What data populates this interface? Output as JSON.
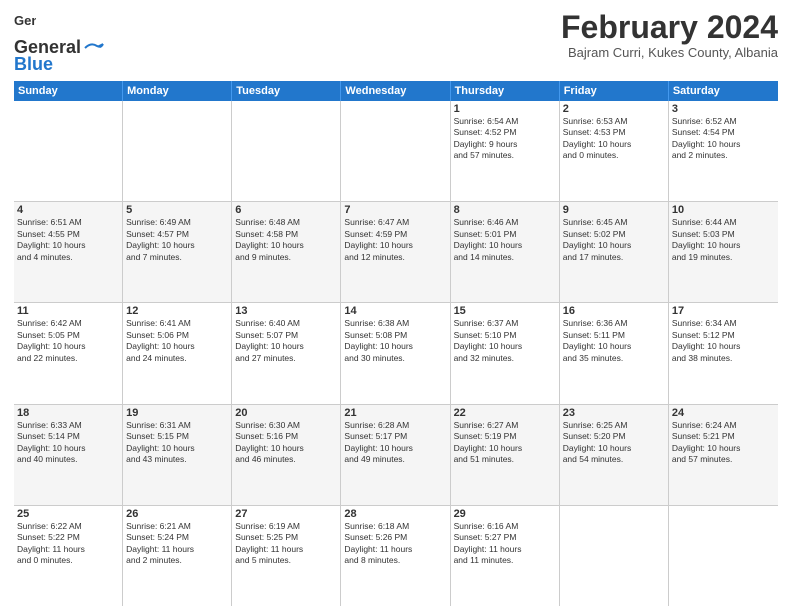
{
  "logo": {
    "line1": "General",
    "line2": "Blue"
  },
  "title": "February 2024",
  "subtitle": "Bajram Curri, Kukes County, Albania",
  "days_header": [
    "Sunday",
    "Monday",
    "Tuesday",
    "Wednesday",
    "Thursday",
    "Friday",
    "Saturday"
  ],
  "weeks": [
    [
      {
        "day": "",
        "info": ""
      },
      {
        "day": "",
        "info": ""
      },
      {
        "day": "",
        "info": ""
      },
      {
        "day": "",
        "info": ""
      },
      {
        "day": "1",
        "info": "Sunrise: 6:54 AM\nSunset: 4:52 PM\nDaylight: 9 hours\nand 57 minutes."
      },
      {
        "day": "2",
        "info": "Sunrise: 6:53 AM\nSunset: 4:53 PM\nDaylight: 10 hours\nand 0 minutes."
      },
      {
        "day": "3",
        "info": "Sunrise: 6:52 AM\nSunset: 4:54 PM\nDaylight: 10 hours\nand 2 minutes."
      }
    ],
    [
      {
        "day": "4",
        "info": "Sunrise: 6:51 AM\nSunset: 4:55 PM\nDaylight: 10 hours\nand 4 minutes."
      },
      {
        "day": "5",
        "info": "Sunrise: 6:49 AM\nSunset: 4:57 PM\nDaylight: 10 hours\nand 7 minutes."
      },
      {
        "day": "6",
        "info": "Sunrise: 6:48 AM\nSunset: 4:58 PM\nDaylight: 10 hours\nand 9 minutes."
      },
      {
        "day": "7",
        "info": "Sunrise: 6:47 AM\nSunset: 4:59 PM\nDaylight: 10 hours\nand 12 minutes."
      },
      {
        "day": "8",
        "info": "Sunrise: 6:46 AM\nSunset: 5:01 PM\nDaylight: 10 hours\nand 14 minutes."
      },
      {
        "day": "9",
        "info": "Sunrise: 6:45 AM\nSunset: 5:02 PM\nDaylight: 10 hours\nand 17 minutes."
      },
      {
        "day": "10",
        "info": "Sunrise: 6:44 AM\nSunset: 5:03 PM\nDaylight: 10 hours\nand 19 minutes."
      }
    ],
    [
      {
        "day": "11",
        "info": "Sunrise: 6:42 AM\nSunset: 5:05 PM\nDaylight: 10 hours\nand 22 minutes."
      },
      {
        "day": "12",
        "info": "Sunrise: 6:41 AM\nSunset: 5:06 PM\nDaylight: 10 hours\nand 24 minutes."
      },
      {
        "day": "13",
        "info": "Sunrise: 6:40 AM\nSunset: 5:07 PM\nDaylight: 10 hours\nand 27 minutes."
      },
      {
        "day": "14",
        "info": "Sunrise: 6:38 AM\nSunset: 5:08 PM\nDaylight: 10 hours\nand 30 minutes."
      },
      {
        "day": "15",
        "info": "Sunrise: 6:37 AM\nSunset: 5:10 PM\nDaylight: 10 hours\nand 32 minutes."
      },
      {
        "day": "16",
        "info": "Sunrise: 6:36 AM\nSunset: 5:11 PM\nDaylight: 10 hours\nand 35 minutes."
      },
      {
        "day": "17",
        "info": "Sunrise: 6:34 AM\nSunset: 5:12 PM\nDaylight: 10 hours\nand 38 minutes."
      }
    ],
    [
      {
        "day": "18",
        "info": "Sunrise: 6:33 AM\nSunset: 5:14 PM\nDaylight: 10 hours\nand 40 minutes."
      },
      {
        "day": "19",
        "info": "Sunrise: 6:31 AM\nSunset: 5:15 PM\nDaylight: 10 hours\nand 43 minutes."
      },
      {
        "day": "20",
        "info": "Sunrise: 6:30 AM\nSunset: 5:16 PM\nDaylight: 10 hours\nand 46 minutes."
      },
      {
        "day": "21",
        "info": "Sunrise: 6:28 AM\nSunset: 5:17 PM\nDaylight: 10 hours\nand 49 minutes."
      },
      {
        "day": "22",
        "info": "Sunrise: 6:27 AM\nSunset: 5:19 PM\nDaylight: 10 hours\nand 51 minutes."
      },
      {
        "day": "23",
        "info": "Sunrise: 6:25 AM\nSunset: 5:20 PM\nDaylight: 10 hours\nand 54 minutes."
      },
      {
        "day": "24",
        "info": "Sunrise: 6:24 AM\nSunset: 5:21 PM\nDaylight: 10 hours\nand 57 minutes."
      }
    ],
    [
      {
        "day": "25",
        "info": "Sunrise: 6:22 AM\nSunset: 5:22 PM\nDaylight: 11 hours\nand 0 minutes."
      },
      {
        "day": "26",
        "info": "Sunrise: 6:21 AM\nSunset: 5:24 PM\nDaylight: 11 hours\nand 2 minutes."
      },
      {
        "day": "27",
        "info": "Sunrise: 6:19 AM\nSunset: 5:25 PM\nDaylight: 11 hours\nand 5 minutes."
      },
      {
        "day": "28",
        "info": "Sunrise: 6:18 AM\nSunset: 5:26 PM\nDaylight: 11 hours\nand 8 minutes."
      },
      {
        "day": "29",
        "info": "Sunrise: 6:16 AM\nSunset: 5:27 PM\nDaylight: 11 hours\nand 11 minutes."
      },
      {
        "day": "",
        "info": ""
      },
      {
        "day": "",
        "info": ""
      }
    ]
  ]
}
